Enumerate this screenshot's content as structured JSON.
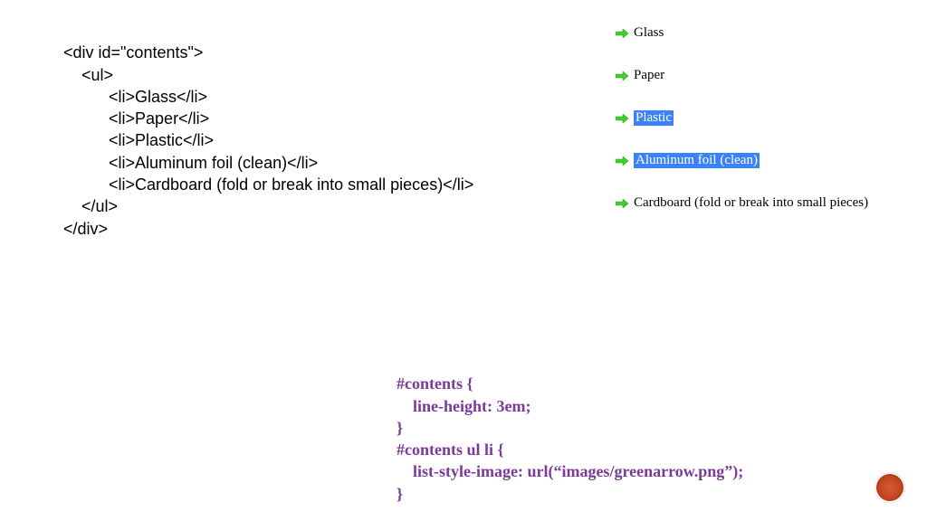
{
  "html_code": {
    "l1": "<div id=\"contents\">",
    "l2": "    <ul>",
    "l3": "          <li>Glass</li>",
    "l4": "          <li>Paper</li>",
    "l5": "          <li>Plastic</li>",
    "l6": "          <li>Aluminum foil (clean)</li>",
    "l7": "          <li>Cardboard (fold or break into small pieces)</li>",
    "l8": "    </ul>",
    "l9": "</div>"
  },
  "preview": {
    "items": [
      {
        "text": "Glass",
        "selected": false
      },
      {
        "text": "Paper",
        "selected": false
      },
      {
        "text": "Plastic",
        "selected": true
      },
      {
        "text": "Aluminum foil (clean)",
        "selected": true
      },
      {
        "text": "Cardboard (fold or break into small pieces)",
        "selected": false
      }
    ]
  },
  "css_code": {
    "l1": "#contents {",
    "l2": "    line-height: 3em;",
    "l3": "}",
    "l4": "#contents ul li {",
    "l5": "    list-style-image: url(“images/greenarrow.png”);",
    "l6": "}"
  }
}
